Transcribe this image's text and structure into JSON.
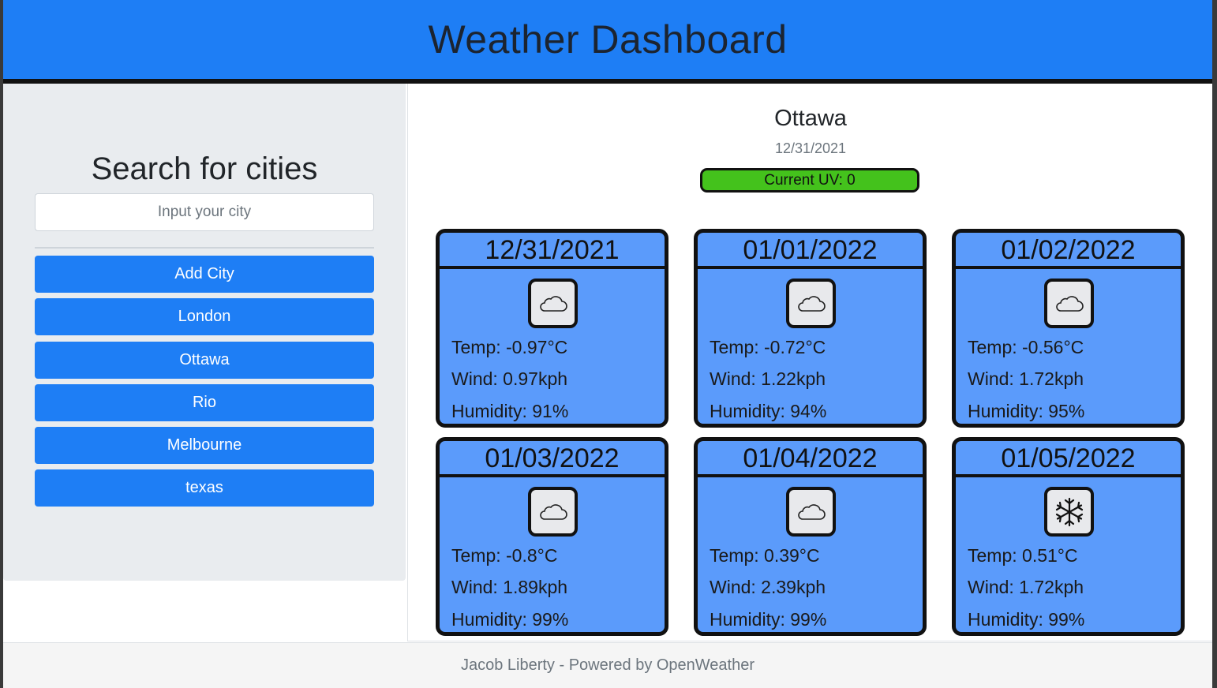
{
  "header": {
    "title": "Weather Dashboard"
  },
  "sidebar": {
    "heading": "Search for cities",
    "search_placeholder": "Input your city",
    "add_button": "Add City",
    "cities": [
      "London",
      "Ottawa",
      "Rio",
      "Melbourne",
      "texas"
    ]
  },
  "current": {
    "city": "Ottawa",
    "date": "12/31/2021",
    "uv_label": "Current UV: 0",
    "uv_color": "#44c21c"
  },
  "forecast": [
    {
      "date": "12/31/2021",
      "icon": "cloud-icon",
      "temp": "Temp: -0.97°C",
      "wind": "Wind: 0.97kph",
      "humidity": "Humidity: 91%"
    },
    {
      "date": "01/01/2022",
      "icon": "cloud-icon",
      "temp": "Temp: -0.72°C",
      "wind": "Wind: 1.22kph",
      "humidity": "Humidity: 94%"
    },
    {
      "date": "01/02/2022",
      "icon": "cloud-icon",
      "temp": "Temp: -0.56°C",
      "wind": "Wind: 1.72kph",
      "humidity": "Humidity: 95%"
    },
    {
      "date": "01/03/2022",
      "icon": "cloud-icon",
      "temp": "Temp: -0.8°C",
      "wind": "Wind: 1.89kph",
      "humidity": "Humidity: 99%"
    },
    {
      "date": "01/04/2022",
      "icon": "cloud-icon",
      "temp": "Temp: 0.39°C",
      "wind": "Wind: 2.39kph",
      "humidity": "Humidity: 99%"
    },
    {
      "date": "01/05/2022",
      "icon": "snowflake-icon",
      "temp": "Temp: 0.51°C",
      "wind": "Wind: 1.72kph",
      "humidity": "Humidity: 99%"
    }
  ],
  "footer": {
    "text": "Jacob Liberty - Powered by OpenWeather"
  },
  "colors": {
    "brand": "#1e7ef5",
    "card": "#5b9bfb",
    "sidebar_bg": "#e9ecef"
  }
}
